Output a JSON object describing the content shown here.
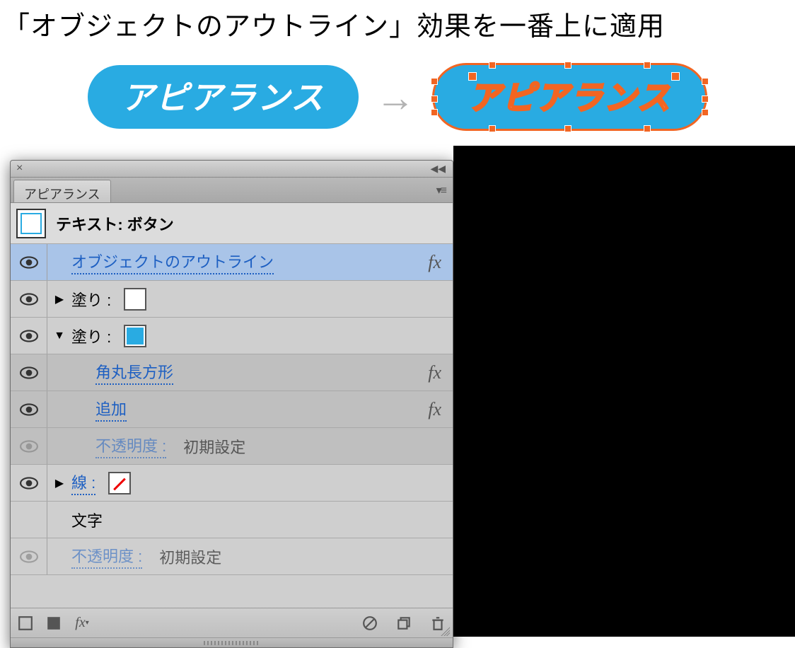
{
  "title": "「オブジェクトのアウトライン」効果を一番上に適用",
  "hero": {
    "pill_text": "アピアランス",
    "arrow": "→"
  },
  "panel": {
    "tab": "アピアランス",
    "header_label": "テキスト: ボタン",
    "rows": {
      "outline_effect": "オブジェクトのアウトライン",
      "fill_label": "塗り :",
      "round_rect": "角丸長方形",
      "add": "追加",
      "opacity_label": "不透明度 :",
      "opacity_value": "初期設定",
      "stroke_label": "線 :",
      "characters": "文字"
    },
    "fx_label": "fx"
  },
  "footer_icons": {
    "no_fill": "no-fill",
    "solid_fill": "solid-fill",
    "fx": "fx",
    "prohibit": "prohibit",
    "duplicate": "duplicate",
    "trash": "trash"
  }
}
